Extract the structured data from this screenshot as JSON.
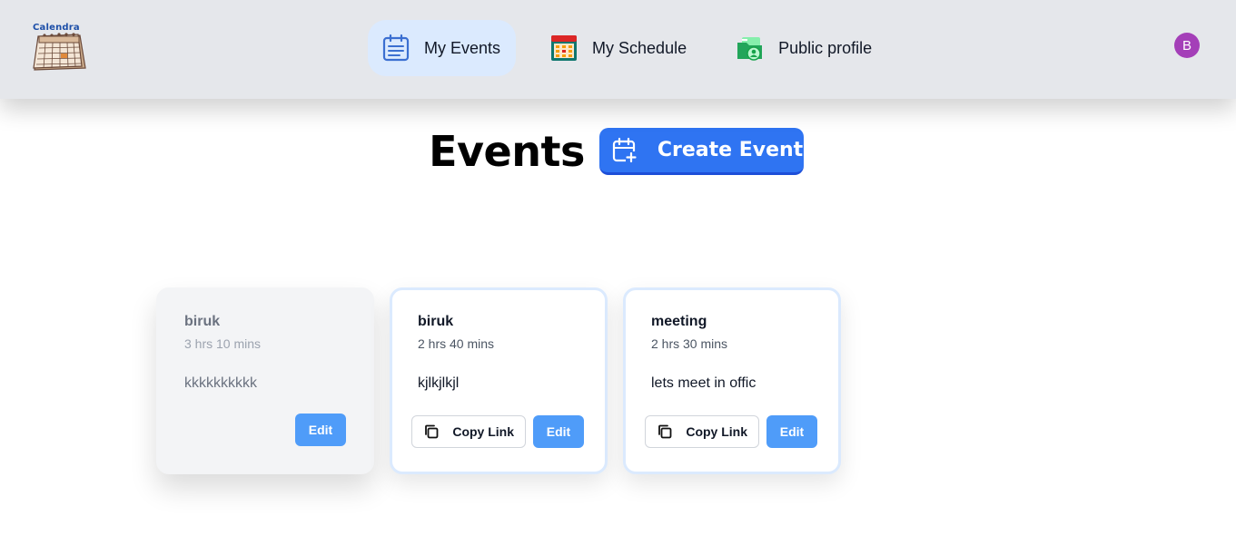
{
  "header": {
    "logo_text": "Calendra",
    "nav": [
      {
        "label": "My Events",
        "icon": "calendar-list-icon",
        "active": true
      },
      {
        "label": "My Schedule",
        "icon": "schedule-grid-icon",
        "active": false
      },
      {
        "label": "Public profile",
        "icon": "public-profile-icon",
        "active": false
      }
    ],
    "avatar_initial": "B"
  },
  "main": {
    "title": "Events",
    "create_button": {
      "label": "Create Event",
      "icon": "calendar-plus-icon"
    }
  },
  "events": [
    {
      "name": "biruk",
      "duration": "3 hrs 10 mins",
      "description": "kkkkkkkkkk",
      "active": false,
      "edit_label": "Edit"
    },
    {
      "name": "biruk",
      "duration": "2 hrs 40 mins",
      "description": "kjlkjlkjl",
      "active": true,
      "copy_label": "Copy Link",
      "edit_label": "Edit"
    },
    {
      "name": "meeting",
      "duration": "2 hrs 30 mins",
      "description": "lets meet in offic",
      "active": true,
      "copy_label": "Copy Link",
      "edit_label": "Edit"
    }
  ],
  "colors": {
    "accent": "#2f74f2",
    "edit_button": "#4f9cf9",
    "nav_active_bg": "#dbeafe",
    "avatar_bg": "#a43fb8",
    "header_bg": "#e5e7eb"
  }
}
